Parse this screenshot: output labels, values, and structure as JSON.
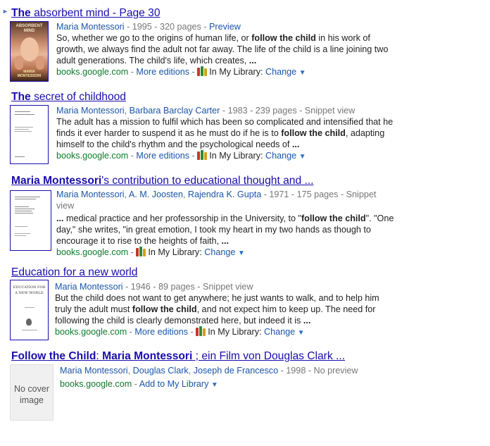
{
  "results": [
    {
      "title_bold": "The",
      "title_rest": " absorbent mind - Page 30",
      "cover_title": "ABSORBENT MIND",
      "cover_author": "MARIA MONTESSORI",
      "authors": "Maria Montessori",
      "meta_rest": " - 1995 - 320 pages - ",
      "preview": "Preview",
      "snippet_1": "So, whether we go to the origins of human life, or ",
      "snippet_b1": "follow the child",
      "snippet_2": " in his work of growth, we always find the adult not far away. The life of the child is a line joining two adult generations. The child's life, which creates, ",
      "snippet_b2": "...",
      "source": "books.google.com",
      "more_editions": "More editions",
      "library_label": "In My Library:",
      "change": "Change"
    },
    {
      "title_bold": "The",
      "title_rest": " secret of childhood",
      "authors_1": "Maria Montessori",
      "authors_2": "Barbara Barclay Carter",
      "meta_rest": " - 1983 - 239 pages - Snippet view",
      "snippet_1": "The adult has a mission to fulfil which has been so complicated and intensified that he finds it ever harder to suspend it as he must do if he is to ",
      "snippet_b1": "follow the child",
      "snippet_2": ", adapting himself to the child's rhythm and the psychological needs of ",
      "snippet_b2": "...",
      "source": "books.google.com",
      "more_editions": "More editions",
      "library_label": "In My Library:",
      "change": "Change"
    },
    {
      "title_bold": "Maria Montessori",
      "title_rest": "'s contribution to educational thought and ...",
      "authors_1": "Maria Montessori",
      "authors_2": "A. M. Joosten",
      "authors_3": "Rajendra K. Gupta",
      "meta_rest": " - 1971 - 175 pages - Snippet view",
      "snippet_b0": "...",
      "snippet_1": " medical practice and her professorship in the University, to \"",
      "snippet_b1": "follow the child",
      "snippet_2": "\". \"One day,\" she writes, \"in great emotion, I took my heart in my two hands as though to encourage it to rise to the heights of faith, ",
      "snippet_b2": "...",
      "source": "books.google.com",
      "library_label": "In My Library:",
      "change": "Change"
    },
    {
      "title_rest": "Education for a new world",
      "cover_title": "EDUCATION FOR A NEW WORLD",
      "authors": "Maria Montessori",
      "meta_rest": " - 1946 - 89 pages - Snippet view",
      "snippet_1": "But the child does not want to get anywhere; he just wants to walk, and to help him truly the adult must ",
      "snippet_b1": "follow the child",
      "snippet_2": ", and not expect him to keep up. The need for following the child is clearly demonstrated here, but indeed it is ",
      "snippet_b2": "...",
      "source": "books.google.com",
      "more_editions": "More editions",
      "library_label": "In My Library:",
      "change": "Change"
    },
    {
      "title_bold_1": "Follow the Child",
      "title_mid": ": ",
      "title_bold_2": "Maria Montessori",
      "title_rest": " ; ein Film von Douglas Clark ...",
      "no_cover": "No cover image",
      "authors_1": "Maria Montessori",
      "authors_2": "Douglas Clark",
      "authors_3": "Joseph de Francesco",
      "meta_rest": " - 1998 - No preview",
      "source": "books.google.com",
      "add_library": "Add to My Library"
    }
  ],
  "sep": " - ",
  "comma": ", ",
  "caret": "▼",
  "arrow": "►",
  "colors": {
    "link": "#1a0dab",
    "meta_link": "#1a55a8",
    "source": "#0f7a2b",
    "meta": "#777777"
  }
}
